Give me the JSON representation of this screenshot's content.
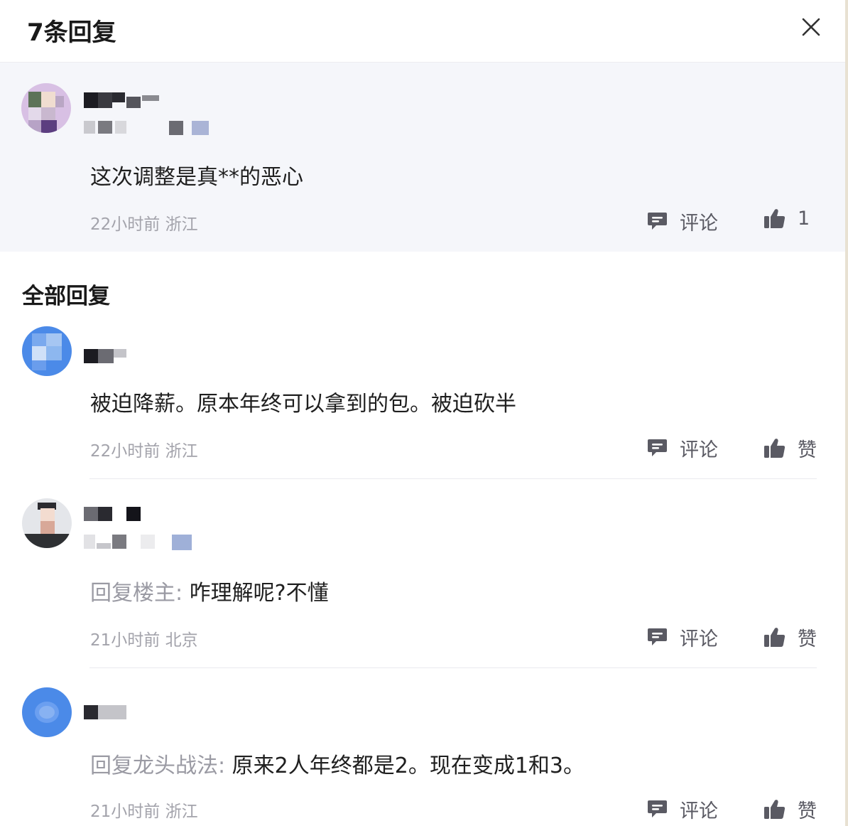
{
  "header": {
    "title": "7条回复",
    "close_icon": "close-icon"
  },
  "main_comment": {
    "content": "这次调整是真**的恶心",
    "time": "22小时前",
    "location": "浙江",
    "comment_label": "评论",
    "like_count": "1"
  },
  "section_title": "全部回复",
  "replies": [
    {
      "content": "被迫降薪。原本年终可以拿到的包。被迫砍半",
      "time": "22小时前",
      "location": "浙江",
      "comment_label": "评论",
      "like_label": "赞"
    },
    {
      "reply_prefix": "回复楼主:",
      "content": "咋理解呢?不懂",
      "time": "21小时前",
      "location": "北京",
      "comment_label": "评论",
      "like_label": "赞"
    },
    {
      "reply_prefix": "回复龙头战法:",
      "content": "原来2人年终都是2。现在变成1和3。",
      "time": "21小时前",
      "location": "浙江",
      "comment_label": "评论",
      "like_label": "赞"
    }
  ],
  "colors": {
    "op_background": "#f5f6fa",
    "meta_text": "#a3a3ab",
    "prefix_text": "#9a9aa3",
    "icon_color": "#5a5a63"
  }
}
